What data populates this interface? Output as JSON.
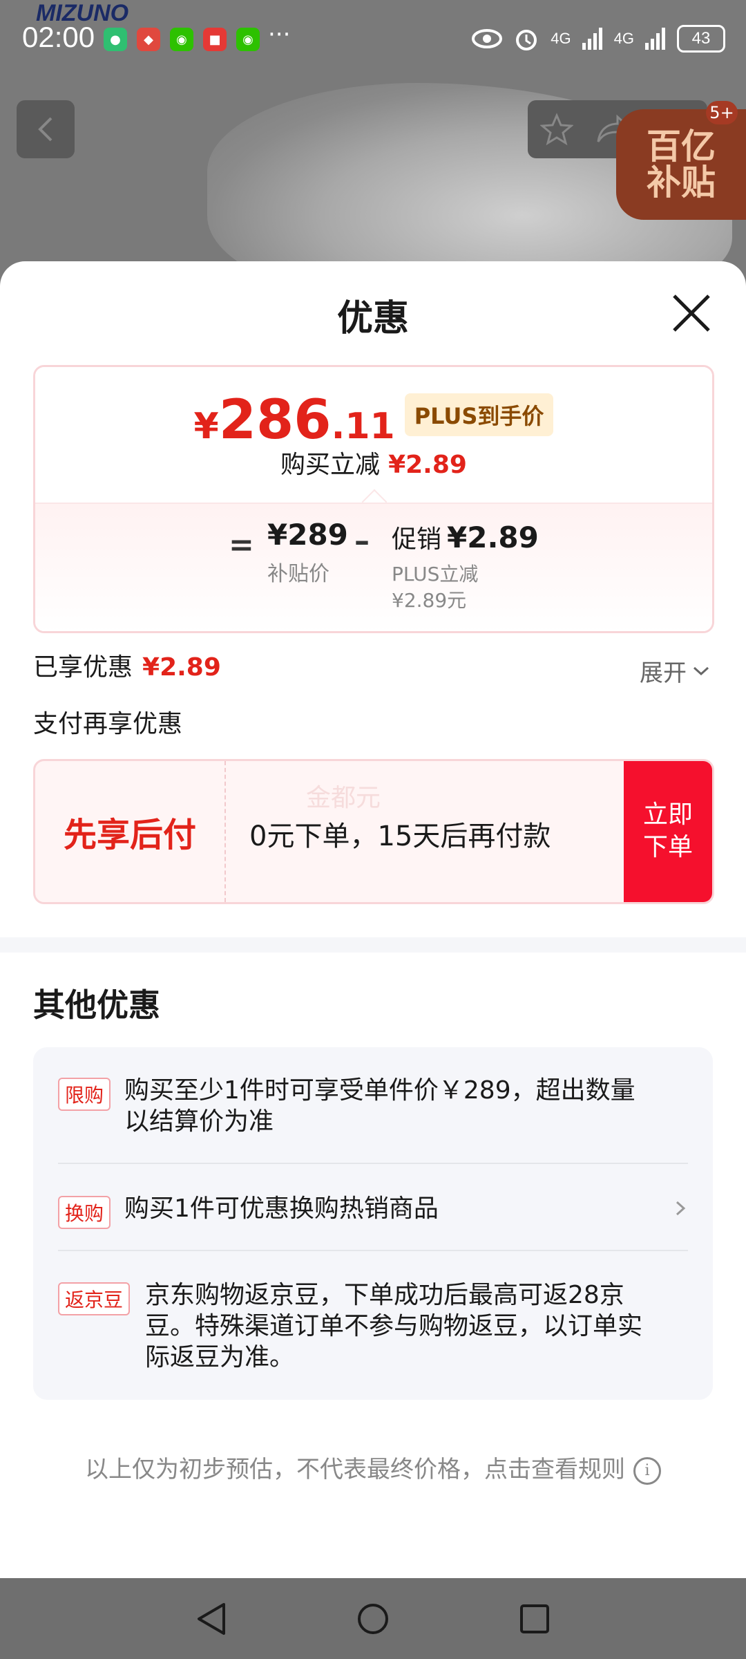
{
  "background": {
    "brand": "MIZUNO",
    "subsidy_tag": [
      "百亿",
      "补贴"
    ],
    "subsidy_badge": "5+"
  },
  "statusbar": {
    "time": "02:00",
    "more": "···",
    "network1": "4G",
    "network2": "4G",
    "battery": "43"
  },
  "sheet": {
    "title": "优惠"
  },
  "price_card": {
    "currency": "¥",
    "price_int": "286",
    "price_dec": ".11",
    "plus_tag": "PLUS到手价",
    "instant_label": "购买立减",
    "instant_value": "¥2.89",
    "equals": "=",
    "subsidy_price": "¥289",
    "subsidy_label": "补贴价",
    "minus": "–",
    "promo_label": "促销",
    "promo_value": "¥2.89",
    "promo_sub1": "PLUS立减",
    "promo_sub2": "¥2.89元"
  },
  "enjoyed": {
    "label": "已享优惠",
    "value": "¥2.89",
    "expand": "展开"
  },
  "pay_again": "支付再享优惠",
  "bnpl": {
    "title": "先享后付",
    "watermark": "金都元",
    "text": "0元下单，15天后再付款",
    "button": "立即\n下单"
  },
  "other": {
    "title": "其他优惠",
    "items": [
      {
        "tag": "限购",
        "line1": "购买至少1件时可享受单件价￥289，超出数量",
        "line2": "以结算价为准"
      },
      {
        "tag": "换购",
        "line1": "购买1件可优惠换购热销商品"
      },
      {
        "tag": "返京豆",
        "line1": "京东购物返京豆，下单成功后最高可返28京",
        "line2": "豆。特殊渠道订单不参与购物返豆，以订单实",
        "line3": "际返豆为准。"
      }
    ]
  },
  "footnote": "以上仅为初步预估，不代表最终价格，点击查看规则",
  "colors": {
    "accent_red": "#e2231a",
    "button_red": "#f5102d",
    "plus_bg": "#fff0d4"
  }
}
